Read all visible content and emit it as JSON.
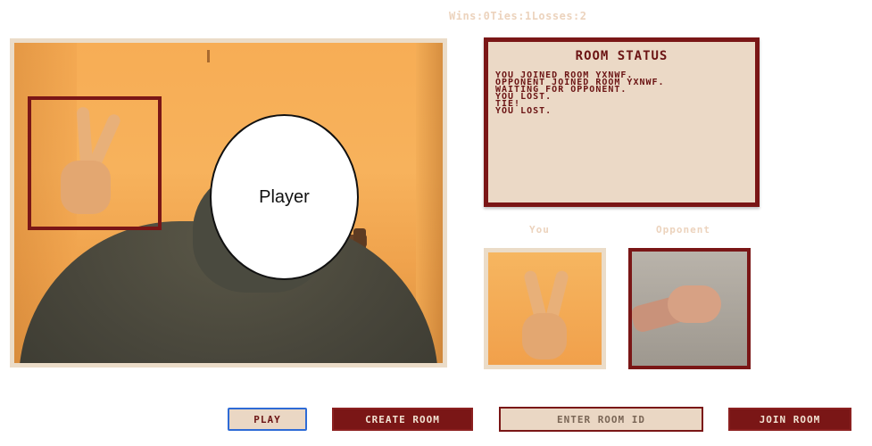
{
  "score": {
    "text": "Wins:0Ties:1Losses:2"
  },
  "webcam": {
    "face_label": "Player"
  },
  "room_status": {
    "title": "ROOM STATUS",
    "log": [
      "YOU JOINED ROOM YXNWF.",
      "OPPONENT JOINED ROOM YXNWF.",
      "WAITING FOR OPPONENT.",
      "YOU LOST.",
      "TIE!",
      "YOU LOST."
    ]
  },
  "labels": {
    "you": "You",
    "opponent": "Opponent"
  },
  "controls": {
    "play": "PLAY",
    "create_room": "CREATE ROOM",
    "room_id_placeholder": "ENTER ROOM ID",
    "join_room": "JOIN ROOM"
  },
  "colors": {
    "accent": "#7a1616",
    "panel": "#ebd9c6",
    "focus": "#2e6bd6"
  }
}
